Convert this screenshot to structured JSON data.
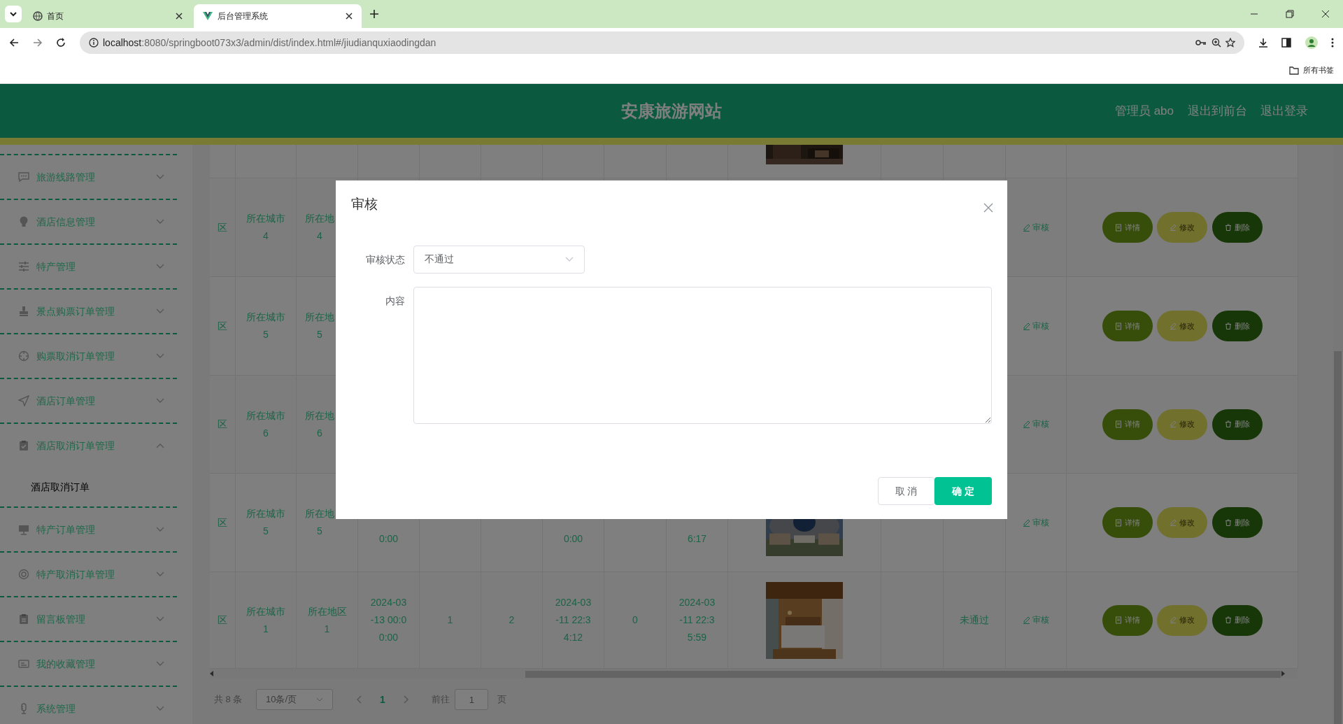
{
  "browser": {
    "tabs": [
      {
        "title": "首页",
        "selected": false
      },
      {
        "title": "后台管理系统",
        "selected": true
      }
    ],
    "url_host": "localhost",
    "url_path": ":8080/springboot073x3/admin/dist/index.html#/jiudianquxiaodingdan",
    "bookmarks": "所有书签"
  },
  "header": {
    "title": "安康旅游网站",
    "links": [
      "管理员 abo",
      "退出到前台",
      "退出登录"
    ]
  },
  "sidebar": {
    "items": [
      {
        "label": "旅游线路管理",
        "expanded": false
      },
      {
        "label": "酒店信息管理",
        "expanded": false
      },
      {
        "label": "特产管理",
        "expanded": false
      },
      {
        "label": "景点购票订单管理",
        "expanded": false
      },
      {
        "label": "购票取消订单管理",
        "expanded": false
      },
      {
        "label": "酒店订单管理",
        "expanded": false
      },
      {
        "label": "酒店取消订单管理",
        "expanded": true,
        "children": [
          {
            "label": "酒店取消订单"
          }
        ]
      },
      {
        "label": "特产订单管理",
        "expanded": false
      },
      {
        "label": "特产取消订单管理",
        "expanded": false
      },
      {
        "label": "留言板管理",
        "expanded": false
      },
      {
        "label": "我的收藏管理",
        "expanded": false
      },
      {
        "label": "系统管理",
        "expanded": false
      }
    ]
  },
  "table": {
    "rows": [
      {
        "column_10": {
          "kind": "picture"
        }
      },
      {
        "column_1": [
          "区"
        ],
        "column_2": [
          "所在城市",
          "4"
        ],
        "column_3": [
          "所在地",
          "4"
        ],
        "column_13": {
          "label": "审核"
        },
        "column_14": [
          {
            "kind": "detail",
            "label": "详情"
          },
          {
            "kind": "edit",
            "label": "修改"
          },
          {
            "kind": "delete",
            "label": "删除"
          }
        ]
      },
      {
        "column_1": [
          "区"
        ],
        "column_2": [
          "所在城市",
          "5"
        ],
        "column_3": [
          "所在地",
          "5"
        ],
        "column_13": {
          "label": "审核"
        },
        "column_14": [
          {
            "kind": "detail",
            "label": "详情"
          },
          {
            "kind": "edit",
            "label": "修改"
          },
          {
            "kind": "delete",
            "label": "删除"
          }
        ]
      },
      {
        "column_1": [
          "区"
        ],
        "column_2": [
          "所在城市",
          "6"
        ],
        "column_3": [
          "所在地",
          "6"
        ],
        "column_13": {
          "label": "审核"
        },
        "column_14": [
          {
            "kind": "detail",
            "label": "详情"
          },
          {
            "kind": "edit",
            "label": "修改"
          },
          {
            "kind": "delete",
            "label": "删除"
          }
        ]
      },
      {
        "column_1": [
          "区"
        ],
        "column_2": [
          "所在城市",
          "5"
        ],
        "column_3": [
          "所在地",
          "5"
        ],
        "column_4": [
          "0:00"
        ],
        "column_7": [
          "0:00"
        ],
        "column_9": [
          "6:17"
        ],
        "column_10": {
          "kind": "picture"
        },
        "column_13": {
          "label": "审核"
        },
        "column_14": [
          {
            "kind": "detail",
            "label": "详情"
          },
          {
            "kind": "edit",
            "label": "修改"
          },
          {
            "kind": "delete",
            "label": "删除"
          }
        ]
      },
      {
        "column_1": [
          "区"
        ],
        "column_2": [
          "所在城市",
          "1"
        ],
        "column_3": [
          "所在地区",
          "1"
        ],
        "column_4": [
          "2024-03",
          "-13 00:0",
          "0:00"
        ],
        "column_5": [
          "1"
        ],
        "column_6": [
          "2"
        ],
        "column_7": [
          "2024-03",
          "-11 22:3",
          "4:12"
        ],
        "column_8": [
          "0"
        ],
        "column_9": [
          "2024-03",
          "-11 22:3",
          "5:59"
        ],
        "column_10": {
          "kind": "picture"
        },
        "column_12": [
          "未通过"
        ],
        "column_13": {
          "label": "审核"
        },
        "column_14": [
          {
            "kind": "detail",
            "label": "详情"
          },
          {
            "kind": "edit",
            "label": "修改"
          },
          {
            "kind": "delete",
            "label": "删除"
          }
        ]
      }
    ]
  },
  "pagination": {
    "total": "共 8 条",
    "page_size": "10条/页",
    "pages": [
      {
        "label": "1",
        "selected": true
      }
    ],
    "goto_label": "前往",
    "goto_value": "1",
    "page_unit": "页"
  },
  "dialog": {
    "title": "审核",
    "fields": [
      {
        "kind": "select",
        "label": "审核状态",
        "value": "不通过"
      },
      {
        "kind": "textarea",
        "label": "内容"
      }
    ],
    "buttons": [
      {
        "kind": "cancel",
        "label": "取 消"
      },
      {
        "kind": "confirm",
        "label": "确 定"
      }
    ]
  }
}
